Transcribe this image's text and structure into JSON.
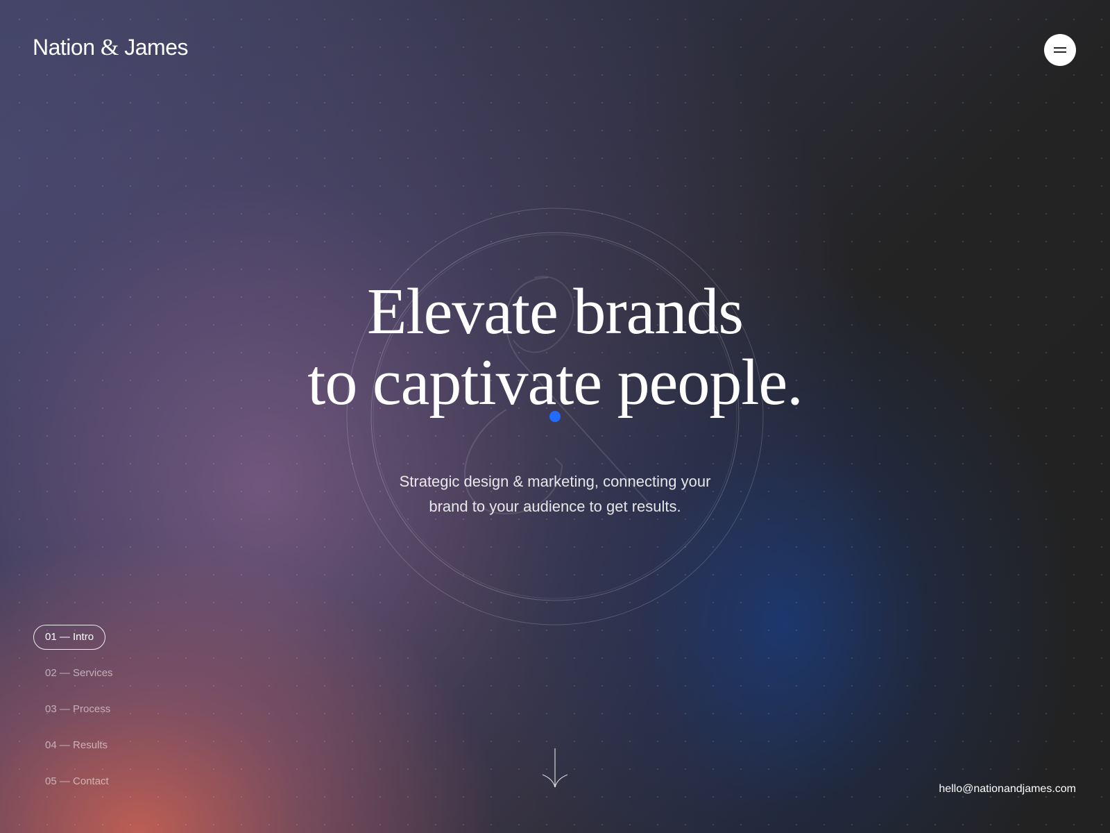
{
  "brand": {
    "name_left": "Nation",
    "ampersand": "&",
    "name_right": "James"
  },
  "header": {
    "menu_icon": "hamburger-menu-icon"
  },
  "hero": {
    "headline_line1": "Elevate brands",
    "headline_line2": "to captivate people.",
    "subtitle_line1": "Strategic design & marketing, connecting your",
    "subtitle_line2": "brand to your audience to get results.",
    "accent_color": "#1f6cff"
  },
  "nav": {
    "items": [
      {
        "label": "01 — Intro",
        "active": true
      },
      {
        "label": "02 — Services",
        "active": false
      },
      {
        "label": "03 — Process",
        "active": false
      },
      {
        "label": "04 — Results",
        "active": false
      },
      {
        "label": "05 — Contact",
        "active": false
      }
    ]
  },
  "scroll": {
    "icon": "arrow-down-icon"
  },
  "footer": {
    "email": "hello@nationandjames.com"
  },
  "colors": {
    "background_dark": "#242424",
    "gradient_warm": "#c46054",
    "gradient_blue": "#1a3a78",
    "gradient_purple": "#785a82"
  }
}
